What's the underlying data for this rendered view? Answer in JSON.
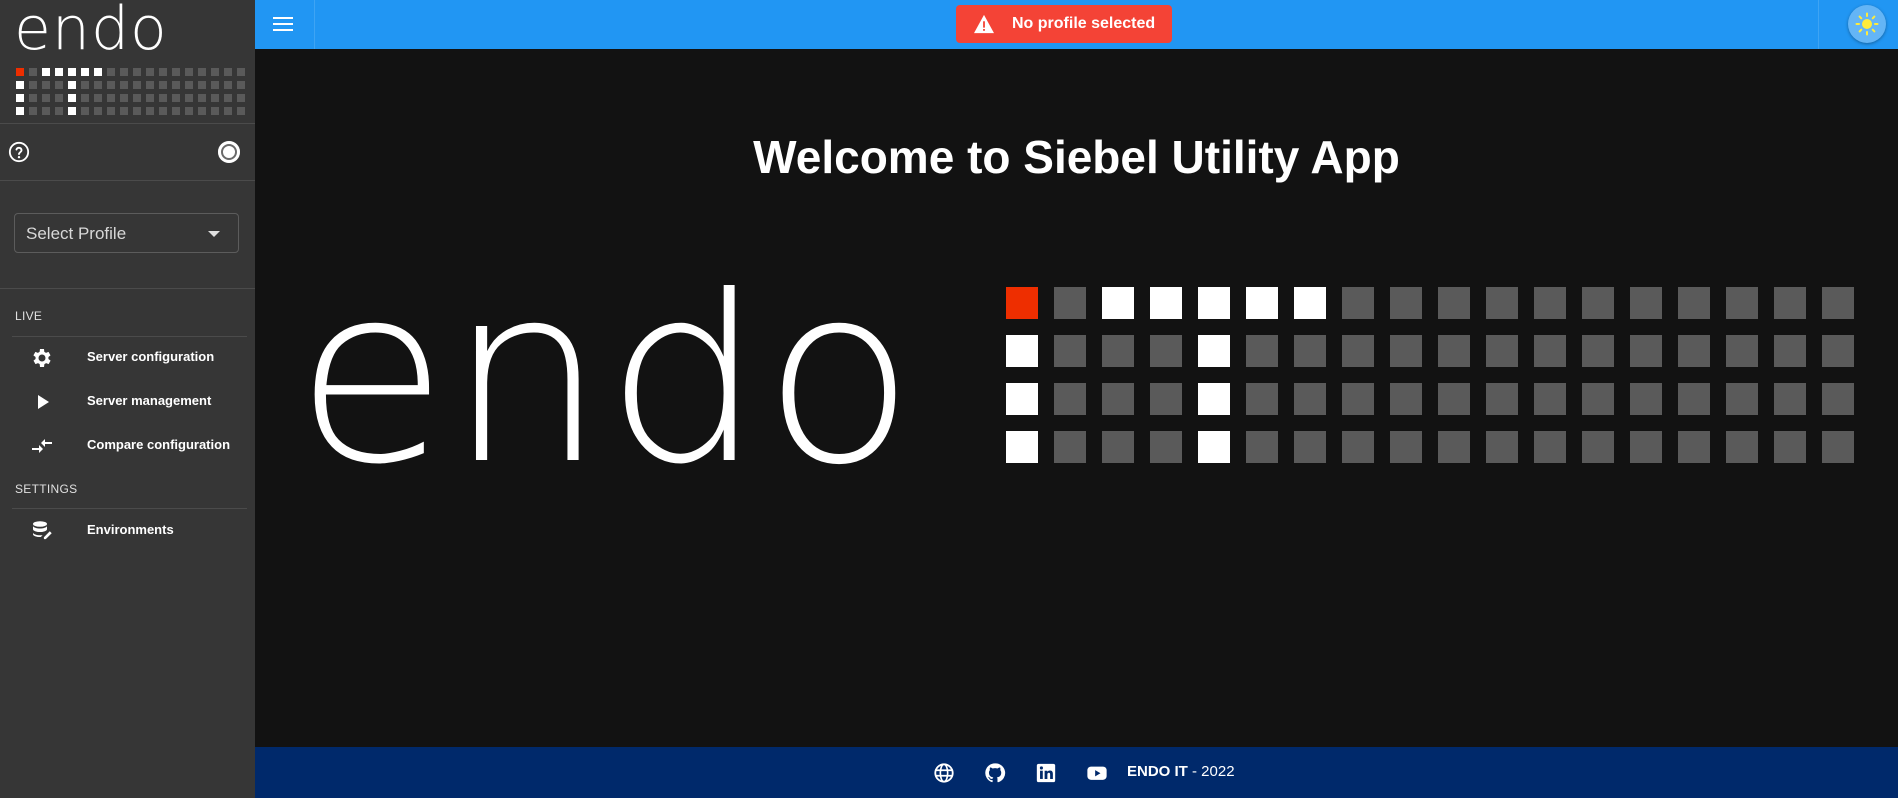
{
  "sidebar": {
    "logo_text": "endo",
    "select_profile_placeholder": "Select Profile",
    "sections": {
      "live": "LIVE",
      "settings": "SETTINGS"
    },
    "items": [
      {
        "label": "Server configuration",
        "icon": "gear-icon"
      },
      {
        "label": "Server management",
        "icon": "play-icon"
      },
      {
        "label": "Compare configuration",
        "icon": "compare-arrows-icon"
      },
      {
        "label": "Environments",
        "icon": "database-edit-icon"
      }
    ]
  },
  "topbar": {
    "alert_text": "No profile selected",
    "alert_color": "#f44336",
    "bar_color": "#2196f3"
  },
  "main": {
    "title": "Welcome to Siebel Utility App",
    "logo_text": "endo",
    "accent_color": "#ee2e00"
  },
  "footer": {
    "brand": "ENDO IT",
    "year_suffix": " - 2022",
    "icons": [
      "globe-icon",
      "github-icon",
      "linkedin-icon",
      "youtube-icon"
    ],
    "bg_color": "#00296b"
  }
}
